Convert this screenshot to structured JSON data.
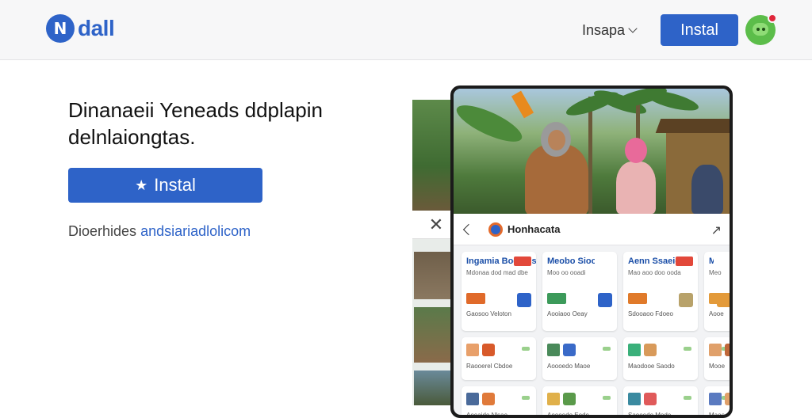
{
  "header": {
    "logo_mark": "N",
    "logo_text": "dall",
    "language": "Insapa",
    "install_label": "Instal"
  },
  "hero": {
    "title": "Dinanaeii Yeneads ddplapin delnlaiongtas.",
    "install_label": "Instal",
    "install_icon": "★",
    "sub_prefix": "Dioerhides",
    "sub_link": "andsiariadlolicom"
  },
  "mockup": {
    "close_icon": "✕",
    "app_name": "Honhacata",
    "share_icon": "↗",
    "cards": [
      {
        "title": "Ingamia Bodoms",
        "subtitle": "Mdonaa dod mad dbe",
        "footer": "Gaosoo Veloton",
        "badge": "#e2483a",
        "img": "#e06a2a",
        "thumb": "#2e63c8"
      },
      {
        "title": "Meobo Sioolra",
        "subtitle": "Moo oo ooadi",
        "footer": "Aooiaoo Oeay",
        "badge": "#ffffff",
        "img": "#3c9a5a",
        "thumb": "#2e63c8"
      },
      {
        "title": "Aenn Ssaeio",
        "subtitle": "Mao aoo doo ooda",
        "footer": "Sdooaoo Fdoeo",
        "badge": "#e2483a",
        "img": "#e07a2a",
        "thumb": "#b8a26a"
      },
      {
        "title": "Mort",
        "subtitle": "Meo",
        "footer": "Aooe",
        "badge": "#ffffff",
        "img": "#e39a3a",
        "thumb": "#e39a3a"
      },
      {
        "title": "",
        "subtitle": "",
        "footer": "Raooerel Cbdoe",
        "badge": "#ffffff",
        "img": "#e8a06a",
        "thumb": "#d85a2a"
      },
      {
        "title": "",
        "subtitle": "",
        "footer": "Aoooedo Maoe",
        "badge": "#ffffff",
        "img": "#4a8a5a",
        "thumb": "#3a6ac8"
      },
      {
        "title": "",
        "subtitle": "",
        "footer": "Maodooe Saodo",
        "badge": "#ffffff",
        "img": "#3ab07a",
        "thumb": "#d89a5a"
      },
      {
        "title": "",
        "subtitle": "",
        "footer": "Mooe",
        "badge": "#ffffff",
        "img": "#e0a06a",
        "thumb": "#c0683a"
      },
      {
        "title": "",
        "subtitle": "",
        "footer": "Aooaido Nlsae",
        "badge": "#ffffff",
        "img": "#4a6a9a",
        "thumb": "#e07a3a"
      },
      {
        "title": "",
        "subtitle": "",
        "footer": "Aoooedo Eode",
        "badge": "#ffffff",
        "img": "#e0b04a",
        "thumb": "#5a9a4a"
      },
      {
        "title": "",
        "subtitle": "",
        "footer": "Saooedo Mode",
        "badge": "#ffffff",
        "img": "#3a8aa0",
        "thumb": "#e05a5a"
      },
      {
        "title": "",
        "subtitle": "",
        "footer": "Maoe",
        "badge": "#ffffff",
        "img": "#5a7ac0",
        "thumb": "#e0a06a"
      }
    ]
  },
  "colors": {
    "brand_blue": "#2e63c8",
    "avatar_green": "#5cbd4a",
    "notification_red": "#e0263a"
  }
}
